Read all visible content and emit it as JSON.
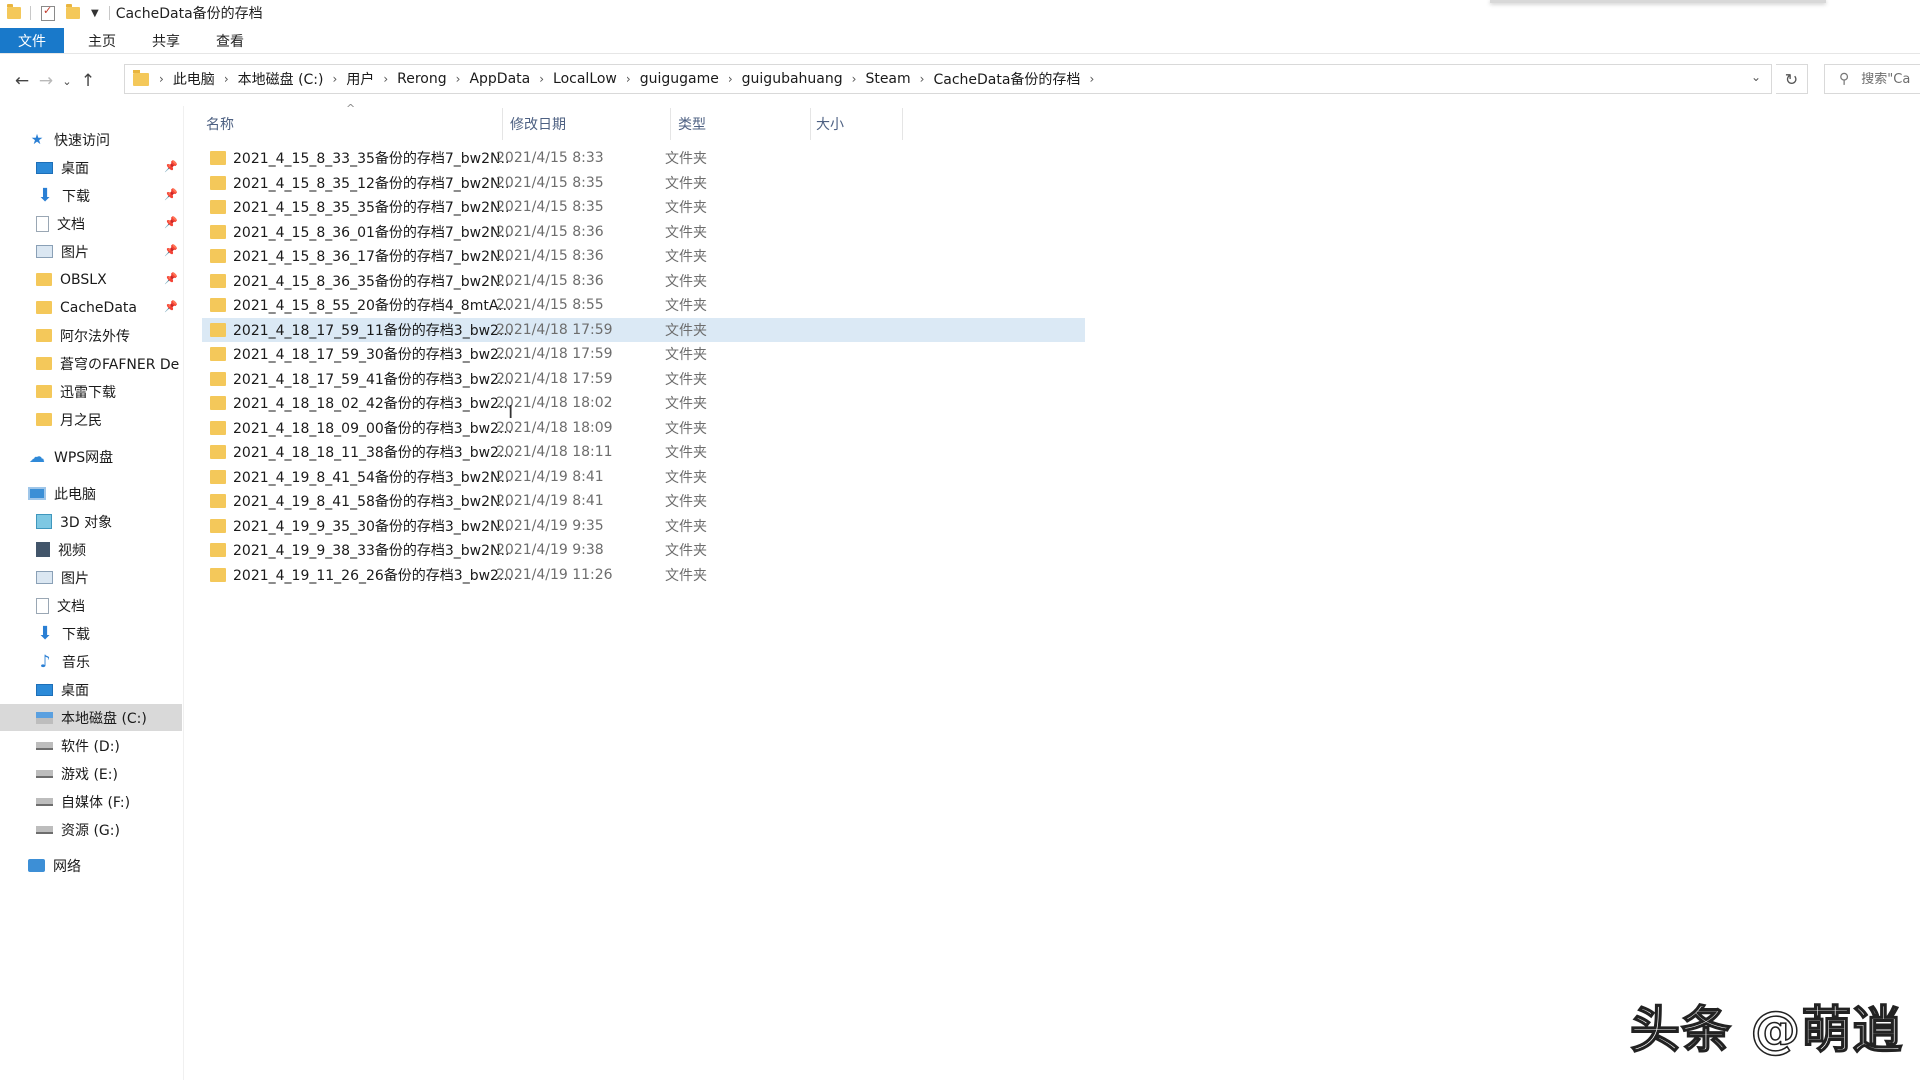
{
  "window": {
    "title": "CacheData备份的存档"
  },
  "ribbon": {
    "tabs": [
      "文件",
      "主页",
      "共享",
      "查看"
    ]
  },
  "address": {
    "crumbs": [
      "此电脑",
      "本地磁盘 (C:)",
      "用户",
      "Rerong",
      "AppData",
      "LocalLow",
      "guigugame",
      "guigubahuang",
      "Steam",
      "CacheData备份的存档"
    ]
  },
  "search": {
    "placeholder": "搜索\"Ca"
  },
  "nav": {
    "quick_access": "快速访问",
    "quick_items": [
      "桌面",
      "下载",
      "文档",
      "图片",
      "OBSLX",
      "CacheData",
      "阿尔法外传",
      "蒼穹のFAFNER De",
      "迅雷下载",
      "月之民"
    ],
    "wps": "WPS网盘",
    "this_pc": "此电脑",
    "pc_items": [
      "3D 对象",
      "视频",
      "图片",
      "文档",
      "下载",
      "音乐",
      "桌面",
      "本地磁盘 (C:)",
      "软件 (D:)",
      "游戏 (E:)",
      "自媒体 (F:)",
      "资源 (G:)"
    ],
    "network": "网络"
  },
  "columns": {
    "name": "名称",
    "date": "修改日期",
    "type": "类型",
    "size": "大小"
  },
  "files": [
    {
      "name": "2021_4_15_8_33_35备份的存档7_bw2N...",
      "date": "2021/4/15 8:33",
      "type": "文件夹"
    },
    {
      "name": "2021_4_15_8_35_12备份的存档7_bw2N...",
      "date": "2021/4/15 8:35",
      "type": "文件夹"
    },
    {
      "name": "2021_4_15_8_35_35备份的存档7_bw2N...",
      "date": "2021/4/15 8:35",
      "type": "文件夹"
    },
    {
      "name": "2021_4_15_8_36_01备份的存档7_bw2N...",
      "date": "2021/4/15 8:36",
      "type": "文件夹"
    },
    {
      "name": "2021_4_15_8_36_17备份的存档7_bw2N...",
      "date": "2021/4/15 8:36",
      "type": "文件夹"
    },
    {
      "name": "2021_4_15_8_36_35备份的存档7_bw2N...",
      "date": "2021/4/15 8:36",
      "type": "文件夹"
    },
    {
      "name": "2021_4_15_8_55_20备份的存档4_8mtA...",
      "date": "2021/4/15 8:55",
      "type": "文件夹"
    },
    {
      "name": "2021_4_18_17_59_11备份的存档3_bw2...",
      "date": "2021/4/18 17:59",
      "type": "文件夹",
      "selected": true
    },
    {
      "name": "2021_4_18_17_59_30备份的存档3_bw2...",
      "date": "2021/4/18 17:59",
      "type": "文件夹"
    },
    {
      "name": "2021_4_18_17_59_41备份的存档3_bw2...",
      "date": "2021/4/18 17:59",
      "type": "文件夹"
    },
    {
      "name": "2021_4_18_18_02_42备份的存档3_bw2...",
      "date": "2021/4/18 18:02",
      "type": "文件夹"
    },
    {
      "name": "2021_4_18_18_09_00备份的存档3_bw2...",
      "date": "2021/4/18 18:09",
      "type": "文件夹"
    },
    {
      "name": "2021_4_18_18_11_38备份的存档3_bw2...",
      "date": "2021/4/18 18:11",
      "type": "文件夹"
    },
    {
      "name": "2021_4_19_8_41_54备份的存档3_bw2N...",
      "date": "2021/4/19 8:41",
      "type": "文件夹"
    },
    {
      "name": "2021_4_19_8_41_58备份的存档3_bw2N...",
      "date": "2021/4/19 8:41",
      "type": "文件夹"
    },
    {
      "name": "2021_4_19_9_35_30备份的存档3_bw2N...",
      "date": "2021/4/19 9:35",
      "type": "文件夹"
    },
    {
      "name": "2021_4_19_9_38_33备份的存档3_bw2N...",
      "date": "2021/4/19 9:38",
      "type": "文件夹"
    },
    {
      "name": "2021_4_19_11_26_26备份的存档3_bw2...",
      "date": "2021/4/19 11:26",
      "type": "文件夹"
    }
  ],
  "watermark": "头条 @萌逍",
  "colors": {
    "accent": "#1979ca",
    "selection": "#dbe9f5",
    "folder": "#f4c85a"
  }
}
